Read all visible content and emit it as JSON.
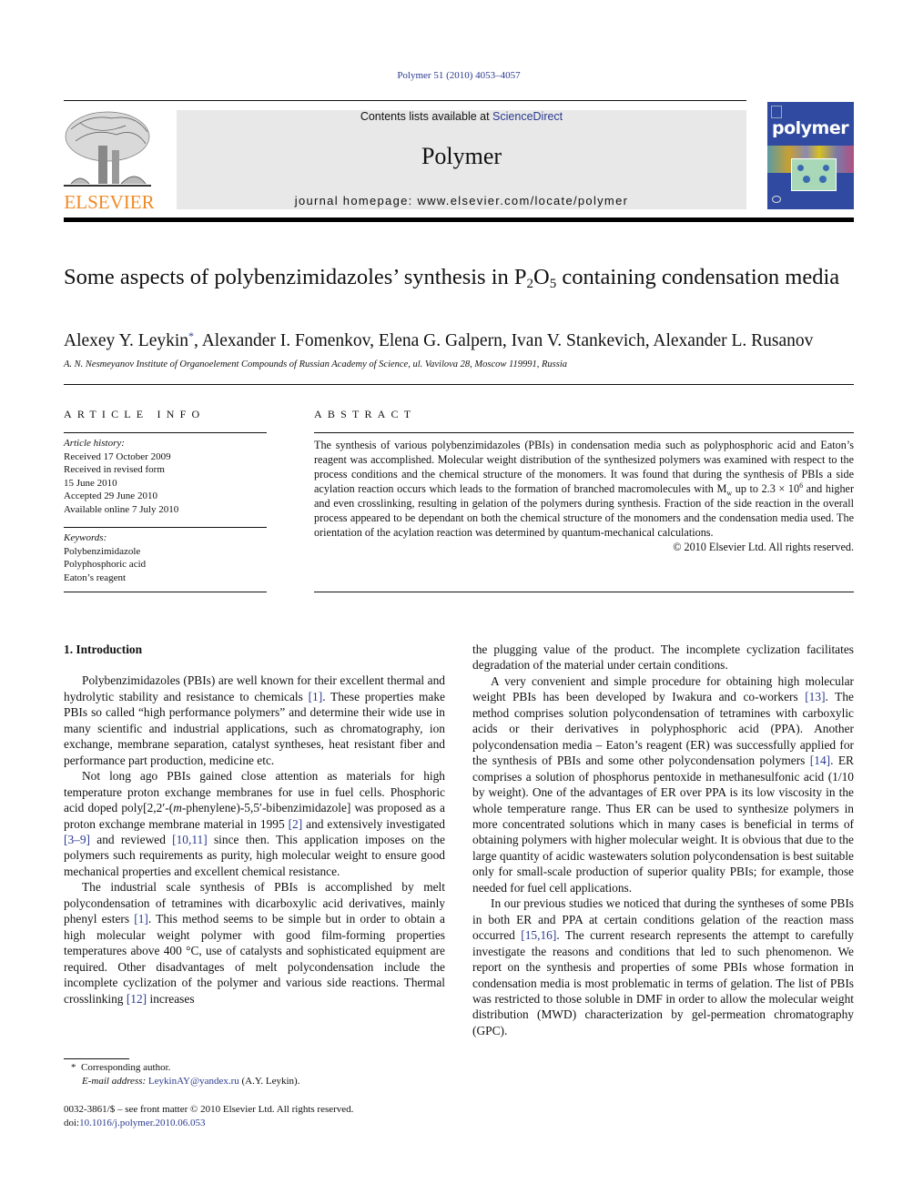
{
  "header": {
    "citation": "Polymer 51 (2010) 4053–4057",
    "contents_prefix": "Contents lists available at ",
    "contents_link": "ScienceDirect",
    "journal_name": "Polymer",
    "homepage": "journal homepage: www.elsevier.com/locate/polymer",
    "publisher_logo_text": "ELSEVIER",
    "cover_title": "polymer",
    "colors": {
      "link": "#2b3a8f",
      "elsevier_orange": "#f08a24",
      "masthead_bg": "#e8e8e8",
      "cover_blue": "#2f4aa0"
    }
  },
  "article": {
    "title_part1": "Some aspects of polybenzimidazoles’ synthesis in P",
    "title_sub1": "2",
    "title_part2": "O",
    "title_sub2": "5",
    "title_part3": " containing condensation media",
    "first_author": "Alexey Y. Leykin",
    "corresponding_mark": "*",
    "other_authors": ", Alexander I. Fomenkov, Elena G. Galpern, Ivan V. Stankevich, Alexander L. Rusanov",
    "affiliation": "A. N. Nesmeyanov Institute of Organoelement Compounds of Russian Academy of Science, ul. Vavilova 28, Moscow 119991, Russia"
  },
  "article_info": {
    "heading": "ARTICLE INFO",
    "history_label": "Article history:",
    "history": [
      "Received 17 October 2009",
      "Received in revised form",
      "15 June 2010",
      "Accepted 29 June 2010",
      "Available online 7 July 2010"
    ],
    "keywords_label": "Keywords:",
    "keywords": [
      "Polybenzimidazole",
      "Polyphosphoric acid",
      "Eaton’s reagent"
    ]
  },
  "abstract": {
    "heading": "ABSTRACT",
    "text_a": "The synthesis of various polybenzimidazoles (PBIs) in condensation media such as polyphosphoric acid and Eaton’s reagent was accomplished. Molecular weight distribution of the synthesized polymers was examined with respect to the process conditions and the chemical structure of the monomers. It was found that during the synthesis of PBIs a side acylation reaction occurs which leads to the formation of branched macromolecules with M",
    "text_sub": "w",
    "text_b": " up to 2.3 × 10",
    "text_sup": "6",
    "text_c": " and higher and even crosslinking, resulting in gelation of the polymers during synthesis. Fraction of the side reaction in the overall process appeared to be dependant on both the chemical structure of the monomers and the condensation media used. The orientation of the acylation reaction was determined by quantum-mechanical calculations.",
    "copyright": "© 2010 Elsevier Ltd. All rights reserved."
  },
  "body": {
    "section_heading": "1.  Introduction",
    "p1": [
      "Polybenzimidazoles (PBIs) are well known for their excellent thermal and hydrolytic stability and resistance to chemicals ",
      "[1]",
      ". These properties make PBIs so called “high performance polymers” and determine their wide use in many scientific and industrial applications, such as chromatography, ion exchange, membrane separation, catalyst syntheses, heat resistant fiber and performance part production, medicine etc."
    ],
    "p2": [
      "Not long ago PBIs gained close attention as materials for high temperature proton exchange membranes for use in fuel cells. Phosphoric acid doped poly[2,2′-(",
      "m",
      "-phenylene)-5,5′-bibenzimidazole] was proposed as a proton exchange membrane material in 1995 ",
      "[2]",
      " and extensively investigated ",
      "[3–9]",
      " and reviewed ",
      "[10,11]",
      " since then. This application imposes on the polymers such requirements as purity, high molecular weight to ensure good mechanical properties and excellent chemical resistance."
    ],
    "p3": [
      "The industrial scale synthesis of PBIs is accomplished by melt polycondensation of tetramines with dicarboxylic acid derivatives, mainly phenyl esters ",
      "[1]",
      ". This method seems to be simple but in order to obtain a high molecular weight polymer with good film-forming properties temperatures above 400 °C, use of catalysts and sophisticated equipment are required. Other disadvantages of melt polycondensation include the incomplete cyclization of the polymer and various side reactions. Thermal crosslinking ",
      "[12]",
      " increases"
    ],
    "p3_cont": "the plugging value of the product. The incomplete cyclization facilitates degradation of the material under certain conditions.",
    "p4": [
      "A very convenient and simple procedure for obtaining high molecular weight PBIs has been developed by Iwakura and co-workers ",
      "[13]",
      ". The method comprises solution polycondensation of tetramines with carboxylic acids or their derivatives in polyphosphoric acid (PPA). Another polycondensation media – Eaton’s reagent (ER) was successfully applied for the synthesis of PBIs and some other polycondensation polymers ",
      "[14]",
      ". ER comprises a solution of phosphorus pentoxide in methanesulfonic acid (1/10 by weight). One of the advantages of ER over PPA is its low viscosity in the whole temperature range. Thus ER can be used to synthesize polymers in more concentrated solutions which in many cases is beneficial in terms of obtaining polymers with higher molecular weight. It is obvious that due to the large quantity of acidic wastewaters solution polycondensation is best suitable only for small-scale production of superior quality PBIs; for example, those needed for fuel cell applications."
    ],
    "p5": [
      "In our previous studies we noticed that during the syntheses of some PBIs in both ER and PPA at certain conditions gelation of the reaction mass occurred ",
      "[15,16]",
      ". The current research represents the attempt to carefully investigate the reasons and conditions that led to such phenomenon. We report on the synthesis and properties of some PBIs whose formation in condensation media is most problematic in terms of gelation. The list of PBIs was restricted to those soluble in DMF in order to allow the molecular weight distribution (MWD) characterization by gel-permeation chromatography (GPC)."
    ]
  },
  "footnote": {
    "mark": "*",
    "corresponding": "Corresponding author.",
    "email_label": "E-mail address:",
    "email": "LeykinAY@yandex.ru",
    "email_suffix": " (A.Y. Leykin)."
  },
  "front_matter": {
    "issn_line": "0032-3861/$ – see front matter © 2010 Elsevier Ltd. All rights reserved.",
    "doi_label": "doi:",
    "doi": "10.1016/j.polymer.2010.06.053"
  }
}
